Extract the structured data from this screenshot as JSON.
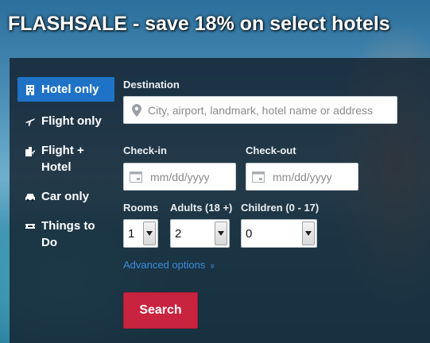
{
  "headline": "FLASHSALE - save 18% on select hotels",
  "nav": {
    "items": [
      {
        "label": "Hotel only",
        "icon": "hotel-icon",
        "active": true
      },
      {
        "label": "Flight only",
        "icon": "plane-icon",
        "active": false
      },
      {
        "label": "Flight + Hotel",
        "icon": "flight-hotel-icon",
        "active": false
      },
      {
        "label": "Car only",
        "icon": "car-icon",
        "active": false
      },
      {
        "label": "Things to Do",
        "icon": "ticket-icon",
        "active": false
      }
    ]
  },
  "form": {
    "destination_label": "Destination",
    "destination_placeholder": "City, airport, landmark, hotel name or address",
    "checkin_label": "Check-in",
    "checkin_placeholder": "mm/dd/yyyy",
    "checkout_label": "Check-out",
    "checkout_placeholder": "mm/dd/yyyy",
    "rooms_label": "Rooms",
    "rooms_value": "1",
    "adults_label": "Adults (18 +)",
    "adults_value": "2",
    "children_label": "Children (0 - 17)",
    "children_value": "0",
    "advanced_label": "Advanced options",
    "advanced_chevron": "»",
    "search_label": "Search"
  },
  "colors": {
    "accent": "#1f73c6",
    "search_button": "#c8233f",
    "link": "#3b8fe0"
  }
}
